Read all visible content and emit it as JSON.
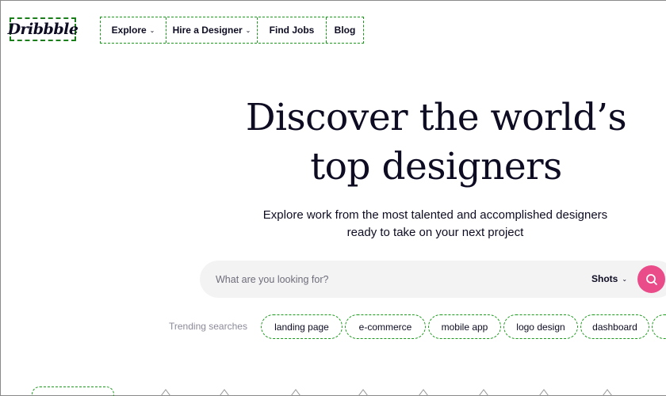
{
  "brand": {
    "logo_text": "Dribbble"
  },
  "nav": {
    "items": [
      {
        "label": "Explore",
        "has_dropdown": true
      },
      {
        "label": "Hire a Designer",
        "has_dropdown": true
      },
      {
        "label": "Find Jobs",
        "has_dropdown": false
      },
      {
        "label": "Blog",
        "has_dropdown": false
      }
    ]
  },
  "hero": {
    "title_line1": "Discover the world’s",
    "title_line2": "top designers",
    "subtitle_line1": "Explore work from the most talented and accomplished designers",
    "subtitle_line2": "ready to take on your next project"
  },
  "search": {
    "placeholder": "What are you looking for?",
    "value": "",
    "scope_selected": "Shots",
    "button_icon": "search-icon"
  },
  "trending": {
    "label": "Trending searches",
    "chips": [
      "landing page",
      "e-commerce",
      "mobile app",
      "logo design",
      "dashboard",
      ""
    ]
  },
  "colors": {
    "accent": "#ea4c89",
    "text": "#0d0c22",
    "muted": "#6e6d7a",
    "search_bg": "#f3f3f4"
  }
}
